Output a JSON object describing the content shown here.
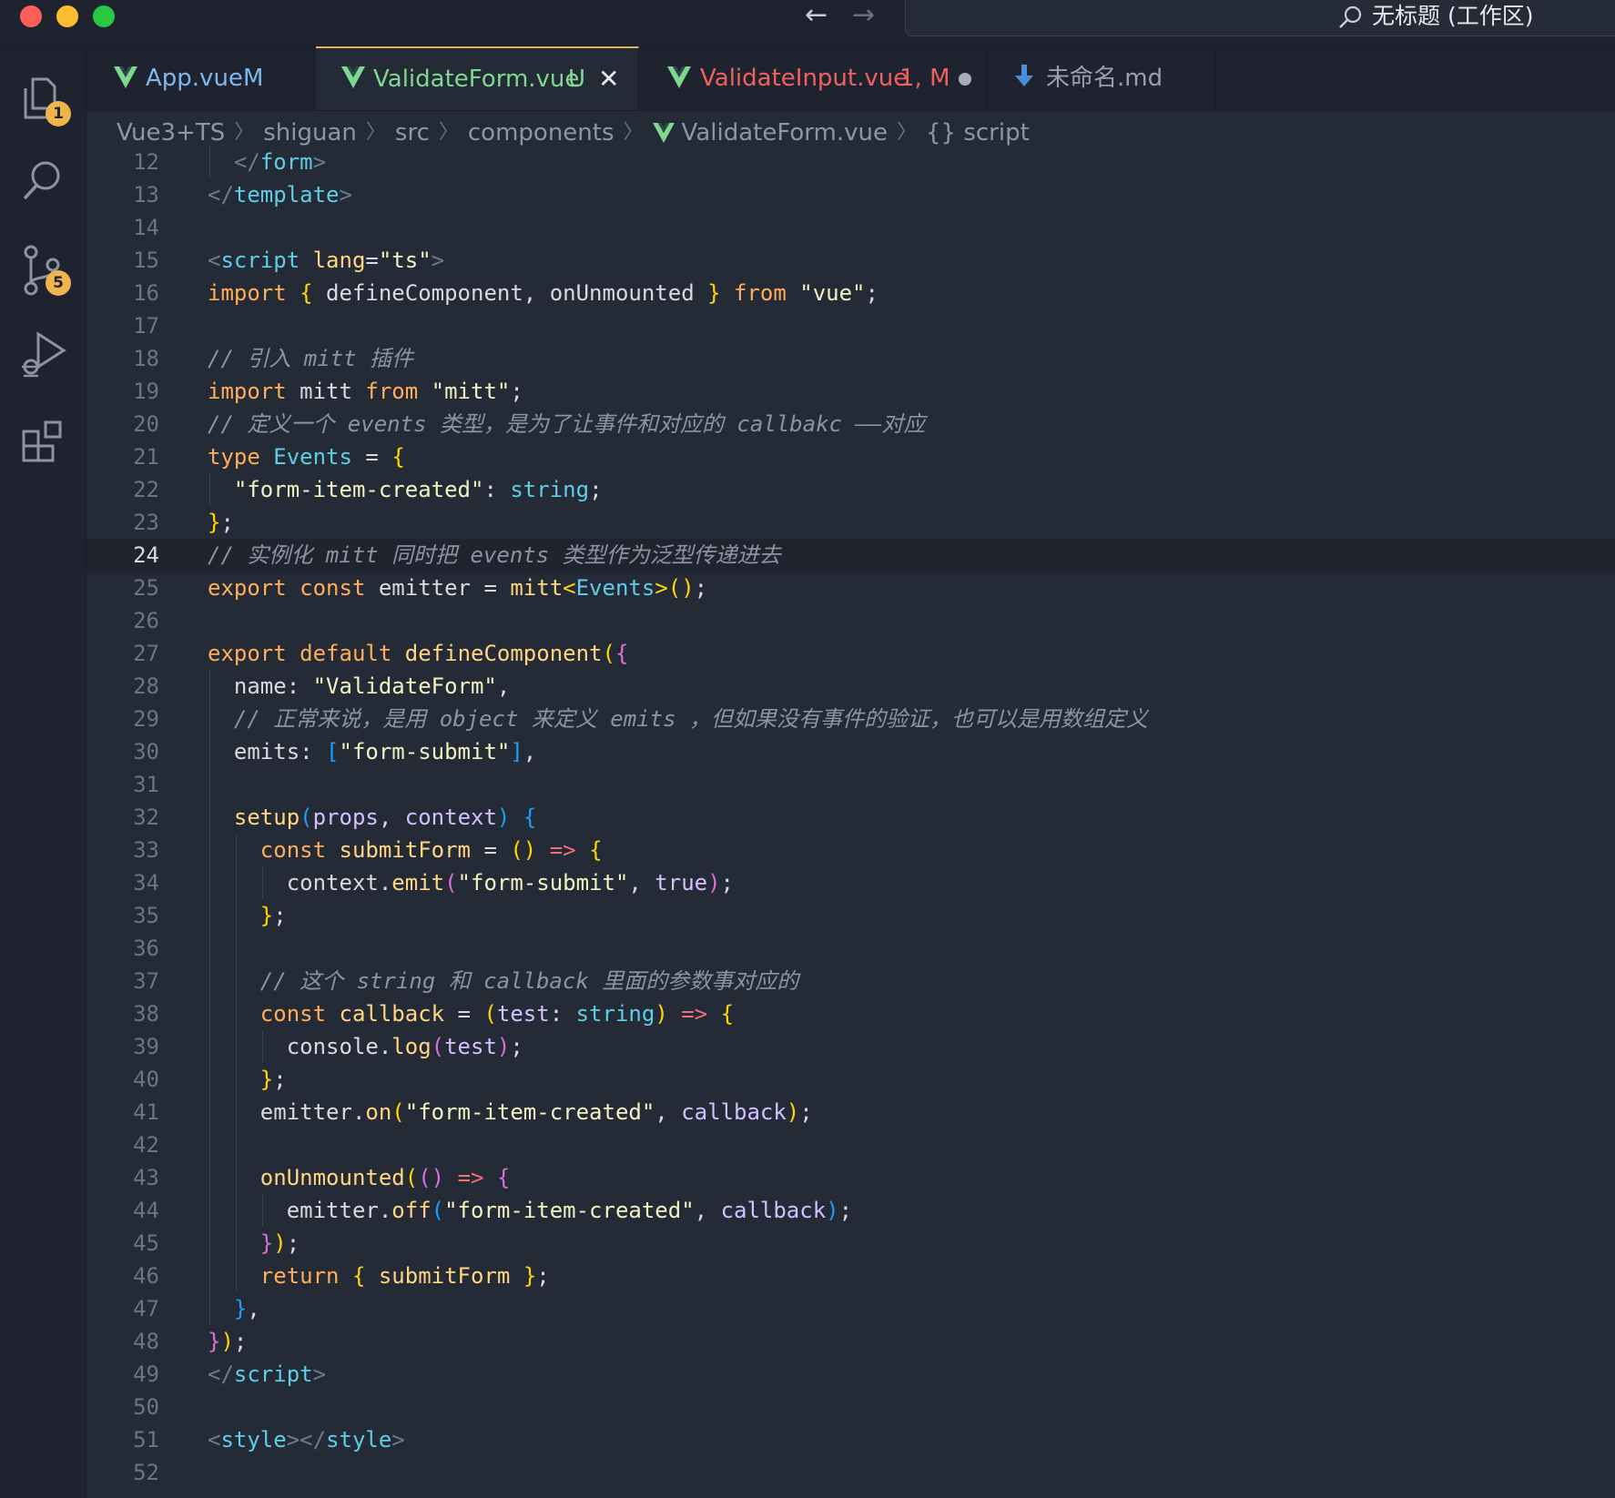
{
  "titlebar": {
    "search_text": "无标题 (工作区)"
  },
  "activity": {
    "explorer_badge": "1",
    "scm_badge": "5"
  },
  "tabs": [
    {
      "label": "App.vue",
      "status": "M",
      "label_color": "#7fb7ea",
      "status_color": "#7fb7ea"
    },
    {
      "label": "ValidateForm.vue",
      "status": "U",
      "label_color": "#7fd88f",
      "status_color": "#7fd88f",
      "active": true
    },
    {
      "label": "ValidateInput.vue",
      "status": "1, M",
      "label_color": "#f0605f",
      "status_color": "#f0605f"
    },
    {
      "label": "未命名.md",
      "status": "",
      "label_color": "#9aa0ae",
      "status_color": "#9aa0ae"
    }
  ],
  "breadcrumb": [
    "Vue3+TS",
    "shiguan",
    "src",
    "components",
    "ValidateForm.vue",
    "{} script"
  ],
  "editor": {
    "current_line": 24,
    "lines": [
      {
        "n": "12"
      },
      {
        "n": "13"
      },
      {
        "n": "14"
      },
      {
        "n": "15"
      },
      {
        "n": "16"
      },
      {
        "n": "17"
      },
      {
        "n": "18"
      },
      {
        "n": "19"
      },
      {
        "n": "20"
      },
      {
        "n": "21"
      },
      {
        "n": "22"
      },
      {
        "n": "23"
      },
      {
        "n": "24"
      },
      {
        "n": "25"
      },
      {
        "n": "26"
      },
      {
        "n": "27"
      },
      {
        "n": "28"
      },
      {
        "n": "29"
      },
      {
        "n": "30"
      },
      {
        "n": "31"
      },
      {
        "n": "32"
      },
      {
        "n": "33"
      },
      {
        "n": "34"
      },
      {
        "n": "35"
      },
      {
        "n": "36"
      },
      {
        "n": "37"
      },
      {
        "n": "38"
      },
      {
        "n": "39"
      },
      {
        "n": "40"
      },
      {
        "n": "41"
      },
      {
        "n": "42"
      },
      {
        "n": "43"
      },
      {
        "n": "44"
      },
      {
        "n": "45"
      },
      {
        "n": "46"
      },
      {
        "n": "47"
      },
      {
        "n": "48"
      },
      {
        "n": "49"
      },
      {
        "n": "50"
      },
      {
        "n": "51"
      },
      {
        "n": "52"
      }
    ],
    "tokens": {
      "l12": [
        "  ",
        "</",
        "form",
        ">"
      ],
      "l13": [
        "</",
        "template",
        ">"
      ],
      "l15": [
        "<",
        "script",
        " ",
        "lang",
        "=",
        "\"ts\"",
        ">"
      ],
      "l16": [
        "import",
        " ",
        "{",
        " defineComponent, onUnmounted ",
        "}",
        " ",
        "from",
        " ",
        "\"vue\"",
        ";"
      ],
      "l18": [
        "// 引入 mitt 插件"
      ],
      "l19": [
        "import",
        " mitt ",
        "from",
        " ",
        "\"mitt\"",
        ";"
      ],
      "l20": [
        "// 定义一个 events 类型，是为了让事件和对应的 callbakc ——对应"
      ],
      "l21": [
        "type",
        " ",
        "Events",
        " = ",
        "{"
      ],
      "l22": [
        "  ",
        "\"form-item-created\"",
        ": ",
        "string",
        ";"
      ],
      "l23": [
        "}",
        ";"
      ],
      "l24": [
        "// 实例化 mitt 同时把 events 类型作为泛型传递进去"
      ],
      "l25": [
        "export",
        " ",
        "const",
        " emitter = ",
        "mitt",
        "<",
        "Events",
        ">",
        "()",
        ";"
      ],
      "l27": [
        "export",
        " ",
        "default",
        " ",
        "defineComponent",
        "(",
        "{"
      ],
      "l28": [
        "  name: ",
        "\"ValidateForm\"",
        ","
      ],
      "l29": [
        "  ",
        "// 正常来说，是用 object 来定义 emits ，但如果没有事件的验证，也可以是用数组定义"
      ],
      "l30": [
        "  emits: ",
        "[",
        "\"form-submit\"",
        "]",
        ","
      ],
      "l32": [
        "  ",
        "setup",
        "(",
        "props",
        ", ",
        "context",
        ")",
        " ",
        "{"
      ],
      "l33": [
        "    ",
        "const",
        " ",
        "submitForm",
        " = ",
        "()",
        " ",
        "=>",
        " ",
        "{"
      ],
      "l34": [
        "      context.",
        "emit",
        "(",
        "\"form-submit\"",
        ", ",
        "true",
        ")",
        ";"
      ],
      "l35": [
        "    ",
        "}",
        ";"
      ],
      "l37": [
        "    ",
        "// 这个 string 和 callback 里面的参数事对应的"
      ],
      "l38": [
        "    ",
        "const",
        " ",
        "callback",
        " = ",
        "(",
        "test",
        ": ",
        "string",
        ")",
        " ",
        "=>",
        " ",
        "{"
      ],
      "l39": [
        "      console.",
        "log",
        "(",
        "test",
        ")",
        ";"
      ],
      "l40": [
        "    ",
        "}",
        ";"
      ],
      "l41": [
        "    emitter.",
        "on",
        "(",
        "\"form-item-created\"",
        ", ",
        "callback",
        ")",
        ";"
      ],
      "l43": [
        "    ",
        "onUnmounted",
        "(",
        "()",
        " ",
        "=>",
        " ",
        "{"
      ],
      "l44": [
        "      emitter.",
        "off",
        "(",
        "\"form-item-created\"",
        ", ",
        "callback",
        ")",
        ";"
      ],
      "l45": [
        "    ",
        "}",
        ")",
        ";"
      ],
      "l46": [
        "    ",
        "return",
        " ",
        "{",
        " ",
        "submitForm",
        " ",
        "}",
        ";"
      ],
      "l47": [
        "  ",
        "}",
        ","
      ],
      "l48": [
        "}",
        ")",
        ";"
      ],
      "l49": [
        "</",
        "script",
        ">"
      ],
      "l51": [
        "<",
        "style",
        "></",
        "style",
        ">"
      ]
    }
  }
}
